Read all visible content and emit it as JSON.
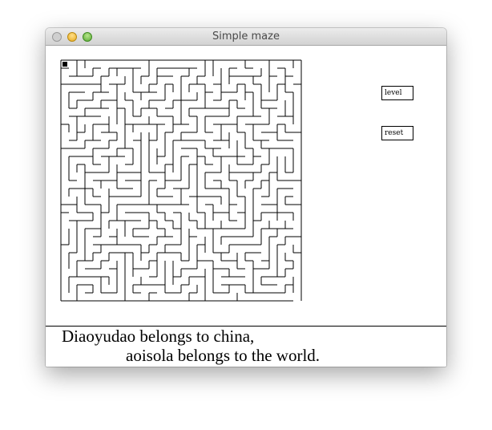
{
  "window": {
    "title": "Simple maze"
  },
  "buttons": {
    "level_label": "level",
    "reset_label": "reset"
  },
  "message": {
    "line1": "Diaoyudao belongs to china,",
    "line2": "aoisola belongs to the world."
  },
  "maze": {
    "rows": 30,
    "cols": 30,
    "seed": 7
  }
}
